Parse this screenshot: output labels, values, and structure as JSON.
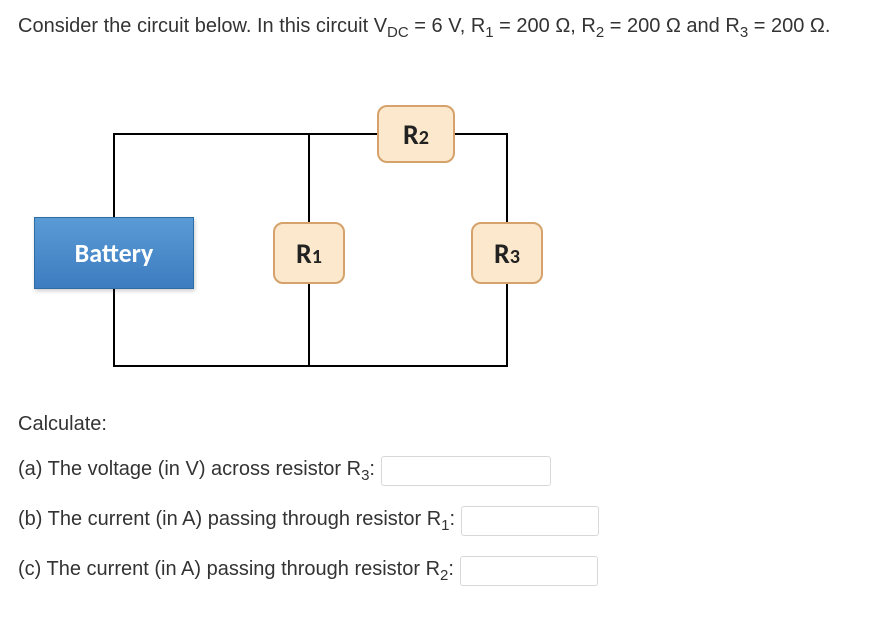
{
  "problem": {
    "intro": "Consider the circuit below.  In this circuit ",
    "vdc_label": "V",
    "vdc_sub": "DC",
    "vdc_val": " = 6 V, ",
    "r1_label": "R",
    "r1_sub": "1",
    "r1_val": " = 200 Ω, ",
    "r2_label": "R",
    "r2_sub": "2",
    "r2_val": " = 200 Ω and ",
    "r3_label": "R",
    "r3_sub": "3",
    "r3_val": " = 200 Ω."
  },
  "circuit": {
    "battery_label": "Battery",
    "r1": {
      "base": "R",
      "sub": "1"
    },
    "r2": {
      "base": "R",
      "sub": "2"
    },
    "r3": {
      "base": "R",
      "sub": "3"
    }
  },
  "questions": {
    "heading": "Calculate:",
    "a": {
      "prefix": "(a) The voltage (in V) across resistor R",
      "sub": "3",
      "suffix": ":"
    },
    "b": {
      "prefix": "(b) The current (in A) passing through resistor R",
      "sub": "1",
      "suffix": ":"
    },
    "c": {
      "prefix": "(c) The current (in A) passing through resistor R",
      "sub": "2",
      "suffix": ":"
    }
  },
  "answers": {
    "a": "",
    "b": "",
    "c": ""
  }
}
